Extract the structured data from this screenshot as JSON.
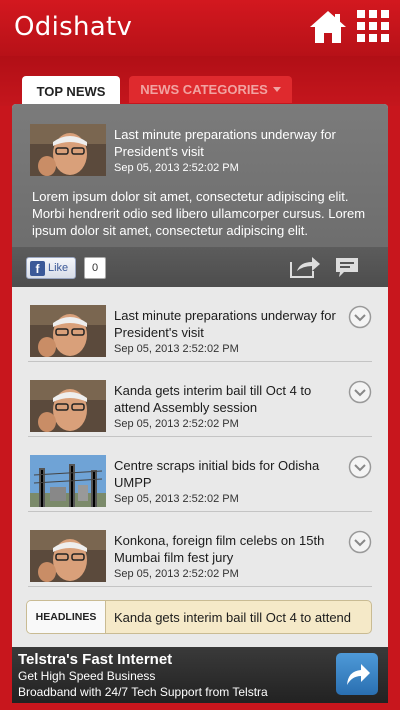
{
  "header": {
    "logo": "Odishatv",
    "home_icon": "home-icon",
    "menu_icon": "grid-menu-icon",
    "color": "#c8161d"
  },
  "tabs": {
    "top_news": "TOP NEWS",
    "news_categories": "NEWS CATEGORIES"
  },
  "featured": {
    "title": "Last minute preparations underway for President's visit",
    "date": "Sep 05, 2013 2:52:02 PM",
    "description": "Lorem ipsum dolor sit amet, consectetur adipiscing elit. Morbi hendrerit odio sed libero ullamcorper cursus. Lorem ipsum dolor sit amet, consectetur adipiscing elit.",
    "like_label": "Like",
    "like_count": "0"
  },
  "news_items": [
    {
      "title": "Last minute preparations underway for President's visit",
      "date": "Sep 05, 2013 2:52:02 PM",
      "thumb": "portrait"
    },
    {
      "title": "Kanda gets interim bail till Oct 4 to attend Assembly session",
      "date": "Sep 05, 2013 2:52:02 PM",
      "thumb": "portrait"
    },
    {
      "title": "Centre scraps initial bids for Odisha UMPP",
      "date": "Sep 05, 2013 2:52:02 PM",
      "thumb": "power-plant"
    },
    {
      "title": "Konkona, foreign film celebs on 15th Mumbai film fest jury",
      "date": "Sep 05, 2013 2:52:02 PM",
      "thumb": "portrait"
    }
  ],
  "ticker": {
    "label": "HEADLINES",
    "text": "Kanda gets interim bail till Oct 4 to attend"
  },
  "ad": {
    "line1": "Telstra's Fast Internet",
    "line2": "Get High Speed Business",
    "line3": "Broadband with 24/7 Tech Support from Telstra"
  }
}
